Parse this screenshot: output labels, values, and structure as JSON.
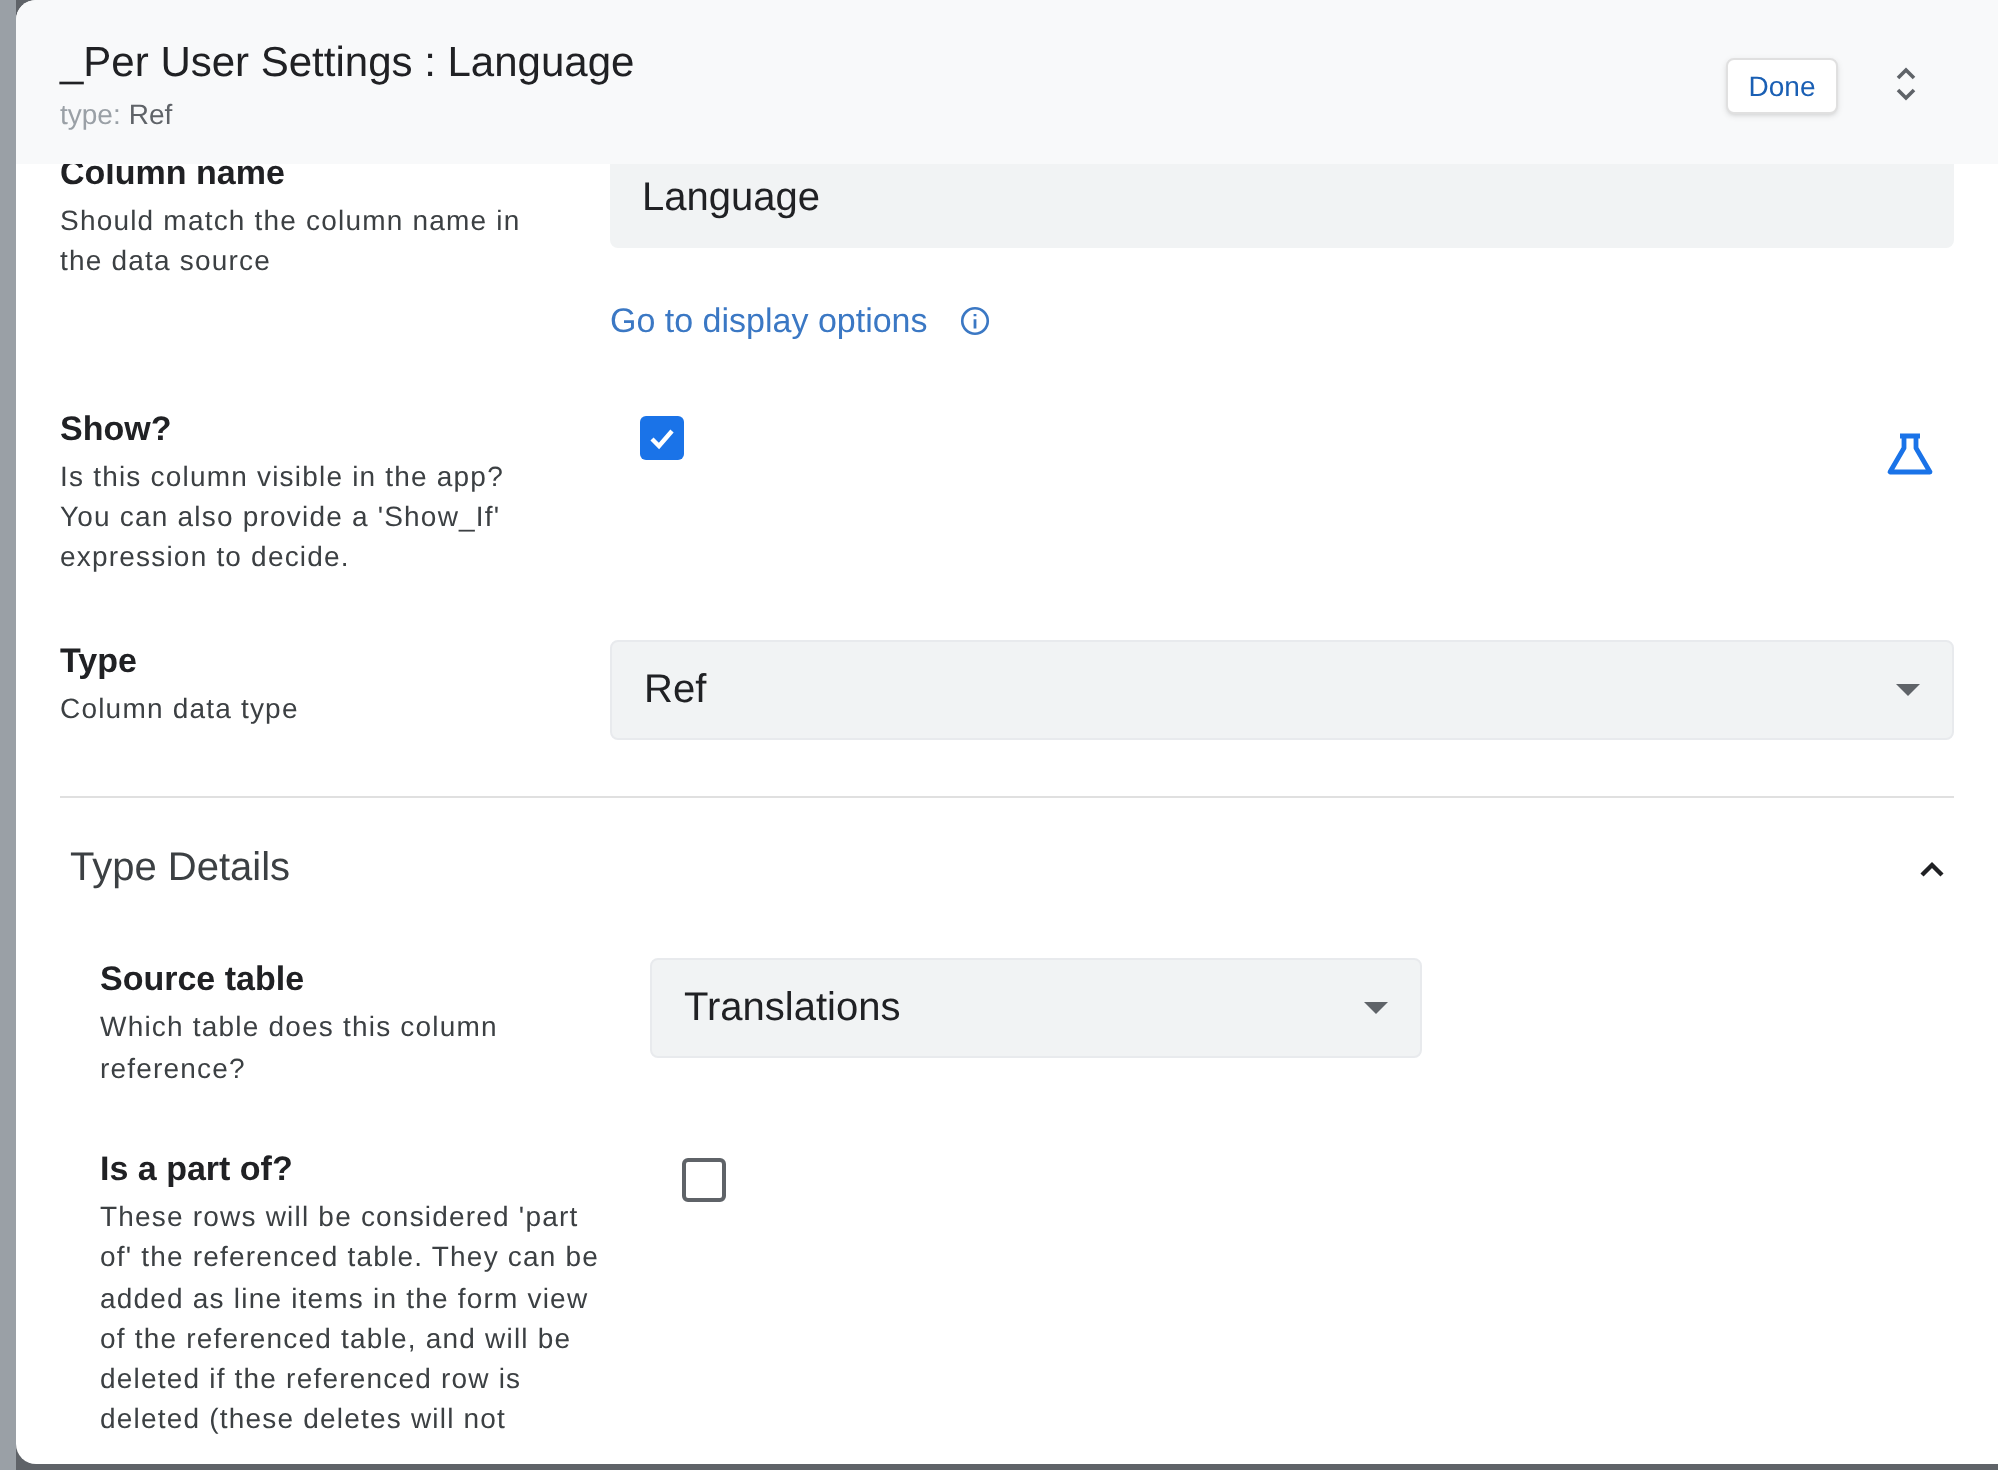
{
  "dialog": {
    "title": "_Per User Settings : Language",
    "subtitle_label": "type:",
    "subtitle_value": "Ref",
    "done_button": "Done"
  },
  "fields": [
    {
      "kind": "text",
      "label": "Column name",
      "description": "Should match the column name in the data source",
      "value": "Language",
      "link": "Go to display options"
    },
    {
      "kind": "checkbox",
      "label": "Show?",
      "description": "Is this column visible in the app? You can also provide a 'Show_If' expression to decide.",
      "checked": true
    },
    {
      "kind": "select",
      "label": "Type",
      "description": "Column data type",
      "value": "Ref"
    }
  ],
  "type_details": {
    "title": "Type Details",
    "expanded": true,
    "fields": [
      {
        "kind": "select",
        "label": "Source table",
        "description": "Which table does this column reference?",
        "value": "Translations"
      },
      {
        "kind": "checkbox",
        "label": "Is a part of?",
        "description": "These rows will be considered 'part of' the referenced table. They can be added as line items in the form view of the referenced table, and will be deleted if the referenced row is deleted (these deletes will not",
        "checked": false
      }
    ]
  }
}
